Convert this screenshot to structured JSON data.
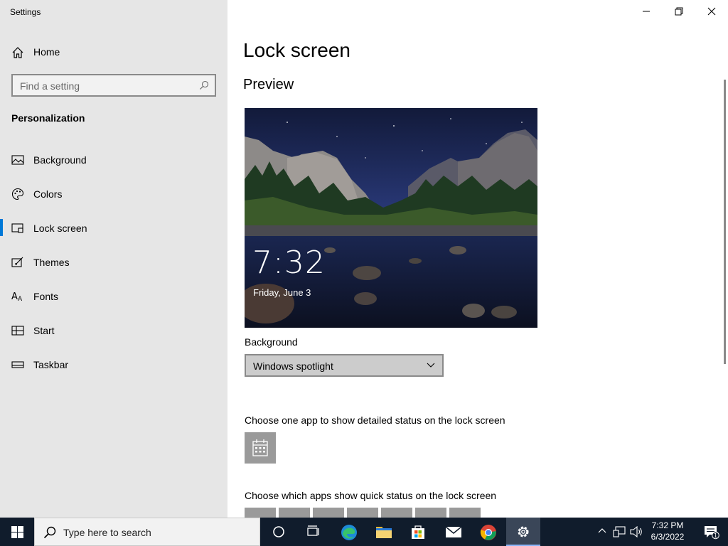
{
  "window": {
    "title": "Settings"
  },
  "sidebar": {
    "home_label": "Home",
    "search_placeholder": "Find a setting",
    "section_title": "Personalization",
    "items": [
      {
        "label": "Background",
        "icon": "image-icon",
        "active": false
      },
      {
        "label": "Colors",
        "icon": "palette-icon",
        "active": false
      },
      {
        "label": "Lock screen",
        "icon": "lock-screen-icon",
        "active": true
      },
      {
        "label": "Themes",
        "icon": "themes-icon",
        "active": false
      },
      {
        "label": "Fonts",
        "icon": "fonts-icon",
        "active": false
      },
      {
        "label": "Start",
        "icon": "start-icon",
        "active": false
      },
      {
        "label": "Taskbar",
        "icon": "taskbar-icon",
        "active": false
      }
    ]
  },
  "main": {
    "title": "Lock screen",
    "preview_title": "Preview",
    "preview": {
      "time": "7:32",
      "date": "Friday, June 3"
    },
    "background_label": "Background",
    "background_value": "Windows spotlight",
    "detailed_status_label": "Choose one app to show detailed status on the lock screen",
    "detailed_status_app_icon": "calendar-icon",
    "quick_status_label": "Choose which apps show quick status on the lock screen"
  },
  "taskbar": {
    "search_placeholder": "Type here to search",
    "time": "7:32 PM",
    "date": "6/3/2022",
    "notification_count": "1",
    "accent_color": "#0078d7"
  }
}
